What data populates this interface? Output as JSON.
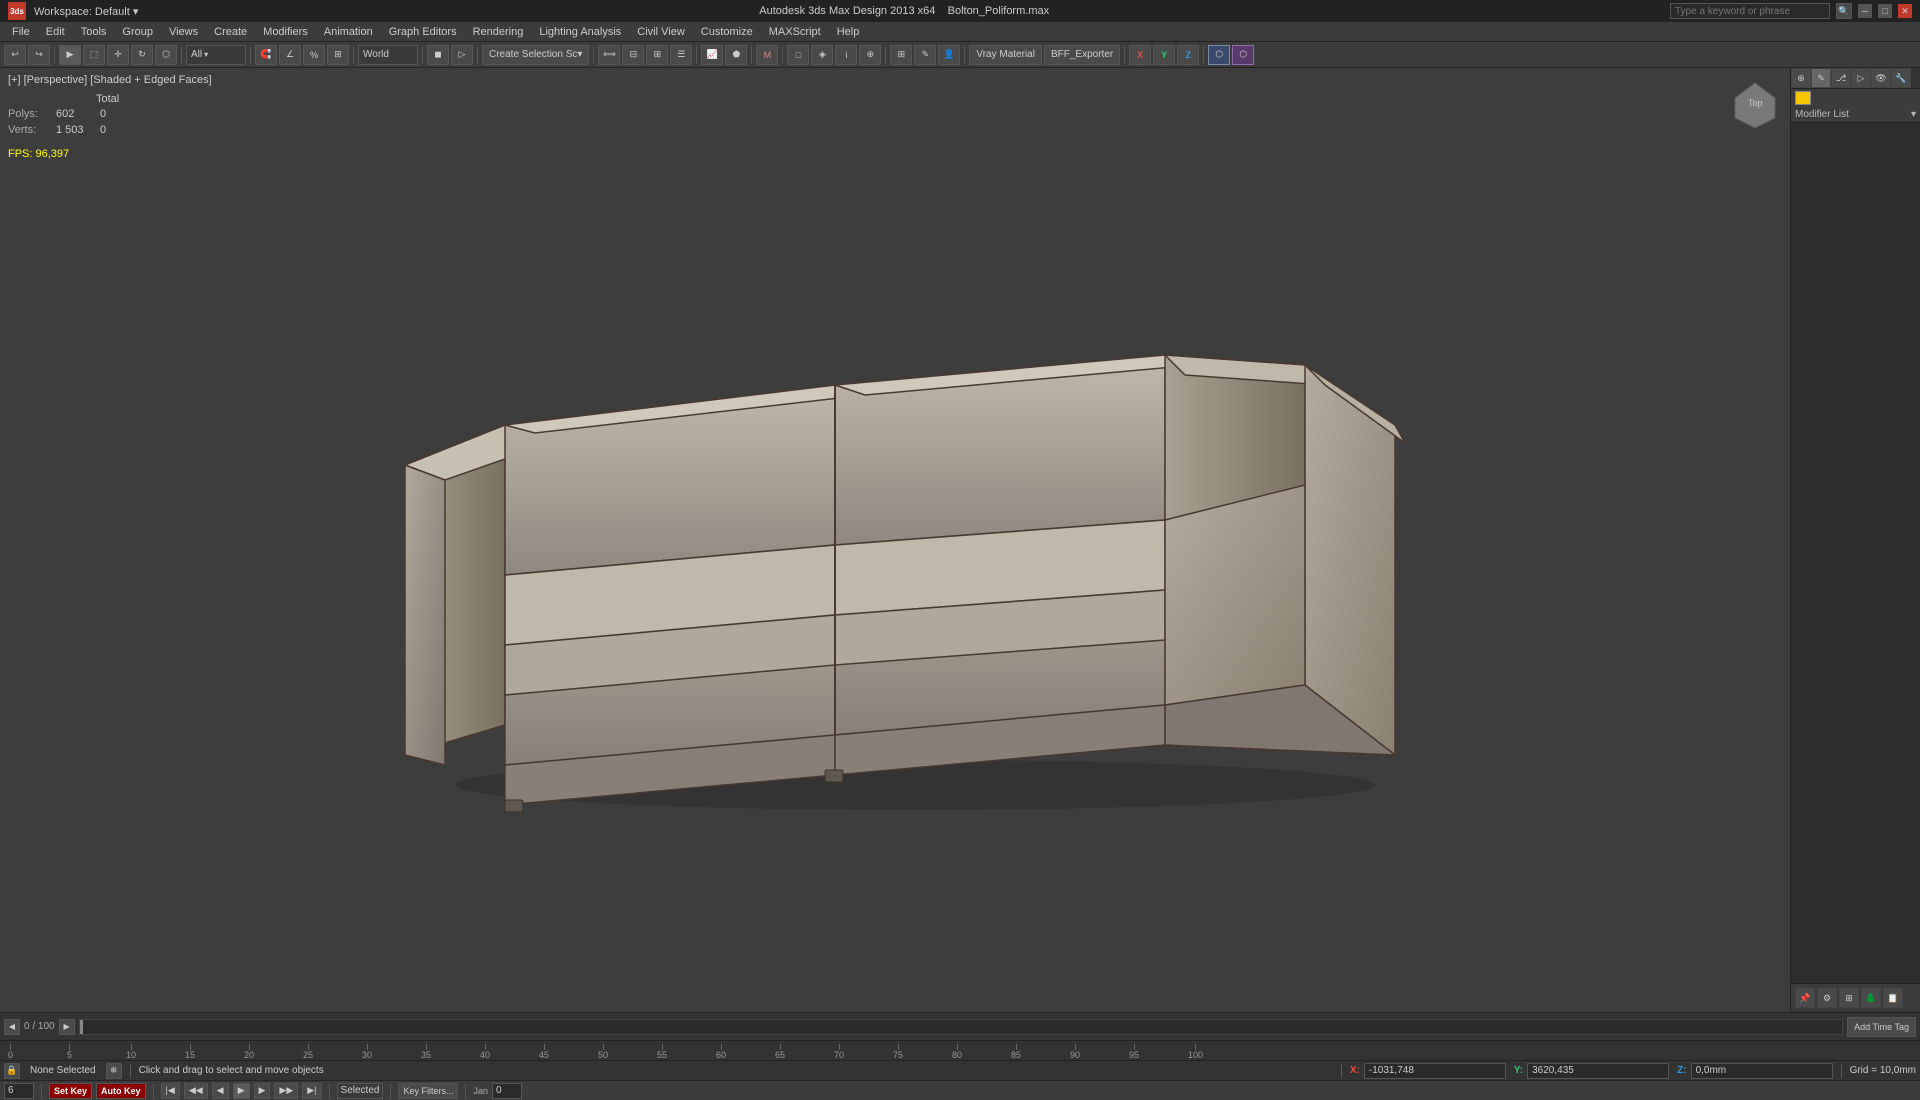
{
  "titlebar": {
    "app_icon": "3ds",
    "workspace_label": "Workspace:",
    "workspace_value": "Default",
    "app_title": "Autodesk 3ds Max Design 2013 x64",
    "file_name": "Bolton_Poliform.max",
    "search_placeholder": "Type a keyword or phrase",
    "min_btn": "─",
    "max_btn": "□",
    "close_btn": "✕"
  },
  "menubar": {
    "items": [
      {
        "id": "file",
        "label": "File"
      },
      {
        "id": "edit",
        "label": "Edit"
      },
      {
        "id": "tools",
        "label": "Tools"
      },
      {
        "id": "group",
        "label": "Group"
      },
      {
        "id": "views",
        "label": "Views"
      },
      {
        "id": "create",
        "label": "Create"
      },
      {
        "id": "modifiers",
        "label": "Modifiers"
      },
      {
        "id": "animation",
        "label": "Animation"
      },
      {
        "id": "graph-editors",
        "label": "Graph Editors"
      },
      {
        "id": "rendering",
        "label": "Rendering"
      },
      {
        "id": "lighting-analysis",
        "label": "Lighting Analysis"
      },
      {
        "id": "civil-view",
        "label": "Civil View"
      },
      {
        "id": "customize",
        "label": "Customize"
      },
      {
        "id": "maxscript",
        "label": "MAXScript"
      },
      {
        "id": "help",
        "label": "Help"
      }
    ]
  },
  "toolbar1": {
    "undo_label": "↩",
    "redo_label": "↪",
    "select_label": "▶",
    "world_label": "World",
    "create_selection_label": "Create Selection Sc",
    "vray_material_label": "Vray Material",
    "bff_exporter_label": "BFF_Exporter"
  },
  "viewport": {
    "label": "[+] [Perspective] [Shaded + Edged Faces]",
    "stats": {
      "polys_label": "Polys:",
      "polys_val": "602",
      "polys_selected": "0",
      "verts_label": "Verts:",
      "verts_val": "1 503",
      "verts_selected": "0",
      "fps_label": "FPS:",
      "fps_val": "96,397",
      "total_label": "Total"
    }
  },
  "right_panel": {
    "modifier_list_label": "Modifier List",
    "color_swatch": "#f5c500"
  },
  "status_bar": {
    "none_selected": "None Selected",
    "hint": "Click and drag to select and move objects",
    "x_label": "X:",
    "x_val": "-1031,748",
    "y_label": "Y:",
    "y_val": "3620,435",
    "z_label": "Z:",
    "z_val": "0,0mm",
    "grid_label": "Grid = 10,0mm",
    "auto_key_label": "Auto Key",
    "selected_label": "Selected",
    "set_key_label": "Set Key",
    "key_filters_label": "Key Filters...",
    "frame_label": "6",
    "time_label": "0 / 100"
  },
  "axes": {
    "x": "X",
    "y": "Y",
    "z": "Z"
  }
}
